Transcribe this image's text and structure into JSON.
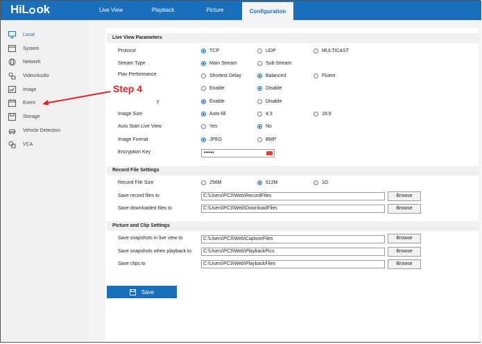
{
  "brand": {
    "logo_left": "HiL",
    "logo_right": "ok"
  },
  "nav": {
    "tabs": [
      {
        "label": "Live View"
      },
      {
        "label": "Playback"
      },
      {
        "label": "Picture"
      },
      {
        "label": "Configuration"
      }
    ]
  },
  "sidebar": {
    "items": [
      {
        "label": "Local",
        "icon": "monitor-icon"
      },
      {
        "label": "System",
        "icon": "system-icon"
      },
      {
        "label": "Network",
        "icon": "globe-icon"
      },
      {
        "label": "Video/Audio",
        "icon": "video-audio-icon"
      },
      {
        "label": "Image",
        "icon": "image-icon"
      },
      {
        "label": "Event",
        "icon": "calendar-icon"
      },
      {
        "label": "Storage",
        "icon": "storage-icon"
      },
      {
        "label": "Vehicle Detection",
        "icon": "vehicle-icon"
      },
      {
        "label": "VCA",
        "icon": "vca-icon"
      }
    ]
  },
  "annotation": {
    "step": "Step 4",
    "color": "#e21f1f"
  },
  "live_view": {
    "title": "Live View Parameters",
    "protocol": {
      "label": "Protocol",
      "options": [
        "TCP",
        "UDP",
        "MULTICAST"
      ],
      "selected": "TCP"
    },
    "stream_type": {
      "label": "Stream Type",
      "options": [
        "Main Stream",
        "Sub-Stream"
      ],
      "selected": "Main Stream"
    },
    "play_performance": {
      "label": "Play Performance",
      "options": [
        "Shortest Delay",
        "Balanced",
        "Fluent"
      ],
      "selected": "Balanced"
    },
    "rules": {
      "options": [
        "Enable",
        "Disable"
      ],
      "selected": "Disable"
    },
    "hidden_row": {
      "label_suffix": "y",
      "options": [
        "Enable",
        "Disable"
      ],
      "selected": "Enable"
    },
    "image_size": {
      "label": "Image Size",
      "options": [
        "Auto-fill",
        "4:3",
        "16:9"
      ],
      "selected": "Auto-fill"
    },
    "auto_start": {
      "label": "Auto Start Live View",
      "options": [
        "Yes",
        "No"
      ],
      "selected": "No"
    },
    "image_format": {
      "label": "Image Format",
      "options": [
        "JPEG",
        "BMP"
      ],
      "selected": "JPEG"
    },
    "encryption_key": {
      "label": "Encryption Key",
      "value": "••••••"
    }
  },
  "record_file": {
    "title": "Record File Settings",
    "size": {
      "label": "Record File Size",
      "options": [
        "256M",
        "512M",
        "1G"
      ],
      "selected": "512M"
    },
    "save_record": {
      "label": "Save record files to",
      "value": "C:\\Users\\PC3\\Web\\RecordFiles",
      "button": "Browse"
    },
    "save_download": {
      "label": "Save downloaded files to",
      "value": "C:\\Users\\PC3\\Web\\DownloadFiles",
      "button": "Browse"
    }
  },
  "picture_clip": {
    "title": "Picture and Clip Settings",
    "snap_live": {
      "label": "Save snapshots in live view to",
      "value": "C:\\Users\\PC3\\Web\\CaptureFiles",
      "button": "Browse"
    },
    "snap_playback": {
      "label": "Save snapshots when playback to",
      "value": "C:\\Users\\PC3\\Web\\PlaybackPics",
      "button": "Browse"
    },
    "clips": {
      "label": "Save clips to",
      "value": "C:\\Users\\PC3\\Web\\PlaybackFiles",
      "button": "Browse"
    }
  },
  "save_button": "Save",
  "colors": {
    "accent": "#1a6fbd",
    "annotation": "#e21f1f"
  }
}
